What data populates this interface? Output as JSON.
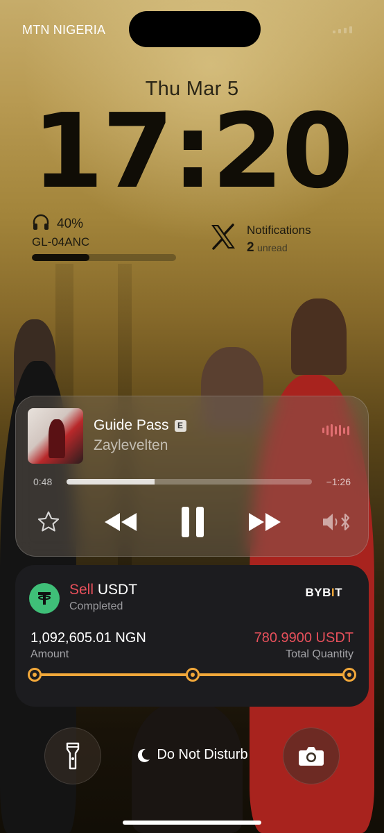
{
  "status_bar": {
    "carrier": "MTN NIGERIA"
  },
  "lock": {
    "date": "Thu Mar 5",
    "time": "17:20"
  },
  "battery_widget": {
    "icon": "headphones-icon",
    "percent_label": "40%",
    "level": 0.4,
    "device": "GL-04ANC"
  },
  "x_widget": {
    "icon": "x-logo-icon",
    "title": "Notifications",
    "count": "2",
    "unread_label": "unread"
  },
  "now_playing": {
    "title": "Guide Pass",
    "explicit_badge": "E",
    "artist": "Zaylevelten",
    "elapsed": "0:48",
    "remaining": "−1:26",
    "progress": 0.36,
    "accent": "#e26f72"
  },
  "trade_card": {
    "icon": "tether-icon",
    "side": "Sell",
    "asset": "USDT",
    "status": "Completed",
    "brand_left": "BYB",
    "brand_mark": "I",
    "brand_right": "T",
    "amount_value": "1,092,605.01 NGN",
    "amount_label": "Amount",
    "qty_value": "780.9900 USDT",
    "qty_label": "Total Quantity",
    "colors": {
      "sell": "#e8505b",
      "progress": "#f2a83a",
      "tether": "#3fbf78"
    }
  },
  "bottom": {
    "flashlight": "flashlight-icon",
    "focus_label": "Do Not Disturb",
    "focus_icon": "moon-icon",
    "camera": "camera-icon"
  }
}
